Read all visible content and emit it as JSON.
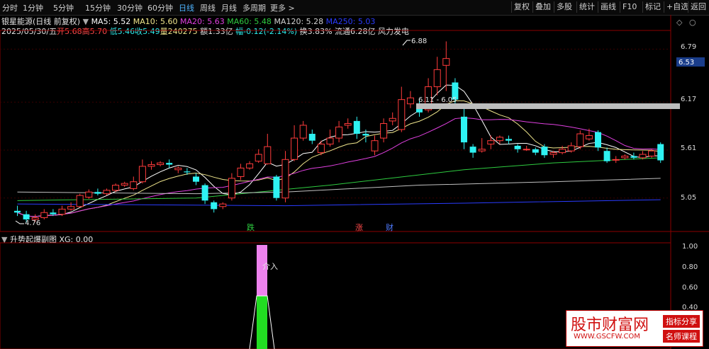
{
  "toolbar": {
    "timeframes": [
      "分时",
      "1分钟",
      "5分钟",
      "15分钟",
      "30分钟",
      "60分钟",
      "日线",
      "周线",
      "月线",
      "多周期",
      "更多 >"
    ],
    "active": "日线",
    "right_buttons": [
      "复权",
      "叠加",
      "多股",
      "统计",
      "画线",
      "F10",
      "标记",
      "+自选",
      "返回"
    ]
  },
  "stock": {
    "title": "银星能源(日线 前复权)",
    "ma": {
      "ma5": "MA5: 5.52",
      "ma10": "MA10: 5.60",
      "ma20": "MA20: 5.63",
      "ma60": "MA60: 5.48",
      "ma120": "MA120: 5.28",
      "ma250": "MA250: 5.03"
    },
    "date": "2025/05/30/五",
    "open_label": "开",
    "open": "5.68",
    "high_label": "高",
    "high": "5.70",
    "low_label": "低",
    "low": "5.46",
    "close_label": "收",
    "close": "5.49",
    "vol_label": "量",
    "vol": "240275",
    "amt_label": "额",
    "amt": "1.33亿",
    "chg_label": "幅",
    "chg": "-0.12(-2.14%)",
    "turnover": "换3.83%",
    "float": "流通6.28亿",
    "concept": "风力发电"
  },
  "price_axis": {
    "ticks": [
      "6.79",
      "6.17",
      "5.61",
      "5.05"
    ],
    "current": "6.53"
  },
  "annotations": {
    "high": "6.88",
    "low": "4.76",
    "range": "6.11 - 6.05",
    "markers": [
      "跌",
      "涨",
      "财"
    ]
  },
  "indicator": {
    "title": "升势起爆副图",
    "xg": "XG: 0.00",
    "ticks": [
      "1.00",
      "0.80",
      "0.60",
      "0.40"
    ],
    "signal": "介入"
  },
  "watermark": {
    "name": "股市财富网",
    "url": "WWW.GSCFW.COM",
    "tag1": "指标分享",
    "tag2": "名师课程"
  },
  "colors": {
    "up": "#ff3b3b",
    "down": "#2ef2f2",
    "ma5": "#ffffff",
    "ma10": "#f0e68c",
    "ma20": "#e040e0",
    "ma60": "#2ecc40",
    "ma120": "#c0c0c0",
    "ma250": "#2a3cff"
  },
  "chart_data": {
    "type": "candlestick",
    "ylim": [
      4.7,
      6.95
    ],
    "candles": [
      [
        4.9,
        4.88,
        4.96,
        4.84
      ],
      [
        4.86,
        4.8,
        4.9,
        4.76
      ],
      [
        4.8,
        4.82,
        4.86,
        4.77
      ],
      [
        4.82,
        4.88,
        4.92,
        4.8
      ],
      [
        4.88,
        4.86,
        4.92,
        4.84
      ],
      [
        4.86,
        4.92,
        4.96,
        4.84
      ],
      [
        4.92,
        4.95,
        5.0,
        4.9
      ],
      [
        4.95,
        5.08,
        5.1,
        4.94
      ],
      [
        5.06,
        5.12,
        5.15,
        5.04
      ],
      [
        5.12,
        5.1,
        5.16,
        5.08
      ],
      [
        5.1,
        5.14,
        5.16,
        5.08
      ],
      [
        5.14,
        5.2,
        5.22,
        5.12
      ],
      [
        5.2,
        5.22,
        5.24,
        5.18
      ],
      [
        5.16,
        5.24,
        5.3,
        5.14
      ],
      [
        5.24,
        5.42,
        5.5,
        5.22
      ],
      [
        5.42,
        5.44,
        5.48,
        5.38
      ],
      [
        5.44,
        5.46,
        5.48,
        5.42
      ],
      [
        5.46,
        5.44,
        5.5,
        5.4
      ],
      [
        5.38,
        5.4,
        5.42,
        5.34
      ],
      [
        5.36,
        5.35,
        5.4,
        5.32
      ],
      [
        5.3,
        5.24,
        5.34,
        5.2
      ],
      [
        5.2,
        5.02,
        5.22,
        4.98
      ],
      [
        5.0,
        4.92,
        5.02,
        4.88
      ],
      [
        4.95,
        4.98,
        5.0,
        4.92
      ],
      [
        5.05,
        5.28,
        5.34,
        5.02
      ],
      [
        5.3,
        5.4,
        5.45,
        5.26
      ],
      [
        5.4,
        5.45,
        5.48,
        5.38
      ],
      [
        5.48,
        5.56,
        5.62,
        5.46
      ],
      [
        5.45,
        5.65,
        5.8,
        5.44
      ],
      [
        5.3,
        5.05,
        5.32,
        5.02
      ],
      [
        5.05,
        5.5,
        5.6,
        5.0
      ],
      [
        5.5,
        5.75,
        5.9,
        5.48
      ],
      [
        5.75,
        5.9,
        5.95,
        5.72
      ],
      [
        5.8,
        5.72,
        5.85,
        5.68
      ],
      [
        5.58,
        5.68,
        5.72,
        5.55
      ],
      [
        5.68,
        5.75,
        5.85,
        5.65
      ],
      [
        5.75,
        5.88,
        5.95,
        5.7
      ],
      [
        5.9,
        5.92,
        5.98,
        5.86
      ],
      [
        5.95,
        5.8,
        6.0,
        5.74
      ],
      [
        5.8,
        5.78,
        5.85,
        5.7
      ],
      [
        5.6,
        5.72,
        5.78,
        5.55
      ],
      [
        5.75,
        5.92,
        5.98,
        5.7
      ],
      [
        5.95,
        5.98,
        6.05,
        5.9
      ],
      [
        5.85,
        6.2,
        6.35,
        5.82
      ],
      [
        6.15,
        6.22,
        6.3,
        6.1
      ],
      [
        6.15,
        6.05,
        6.2,
        6.0
      ],
      [
        6.08,
        6.35,
        6.45,
        6.05
      ],
      [
        6.35,
        6.55,
        6.7,
        6.25
      ],
      [
        6.6,
        6.68,
        6.88,
        6.3
      ],
      [
        6.4,
        6.2,
        6.45,
        6.1
      ],
      [
        6.0,
        5.7,
        6.1,
        5.62
      ],
      [
        5.65,
        5.58,
        5.68,
        5.52
      ],
      [
        5.6,
        5.62,
        5.75,
        5.58
      ],
      [
        5.68,
        5.72,
        5.78,
        5.62
      ],
      [
        5.72,
        5.76,
        5.78,
        5.68
      ],
      [
        5.74,
        5.72,
        5.78,
        5.68
      ],
      [
        5.66,
        5.62,
        5.68,
        5.58
      ],
      [
        5.62,
        5.62,
        5.66,
        5.6
      ],
      [
        5.62,
        5.58,
        5.64,
        5.55
      ],
      [
        5.65,
        5.55,
        5.68,
        5.52
      ],
      [
        5.56,
        5.58,
        5.6,
        5.52
      ],
      [
        5.58,
        5.62,
        5.66,
        5.56
      ],
      [
        5.6,
        5.66,
        5.7,
        5.58
      ],
      [
        5.65,
        5.8,
        5.84,
        5.62
      ],
      [
        5.74,
        5.78,
        5.86,
        5.72
      ],
      [
        5.82,
        5.64,
        5.84,
        5.6
      ],
      [
        5.6,
        5.48,
        5.64,
        5.46
      ],
      [
        5.5,
        5.5,
        5.54,
        5.46
      ],
      [
        5.52,
        5.54,
        5.56,
        5.5
      ],
      [
        5.54,
        5.52,
        5.58,
        5.5
      ],
      [
        5.52,
        5.56,
        5.6,
        5.5
      ],
      [
        5.54,
        5.6,
        5.62,
        5.52
      ],
      [
        5.68,
        5.49,
        5.7,
        5.46
      ]
    ]
  }
}
